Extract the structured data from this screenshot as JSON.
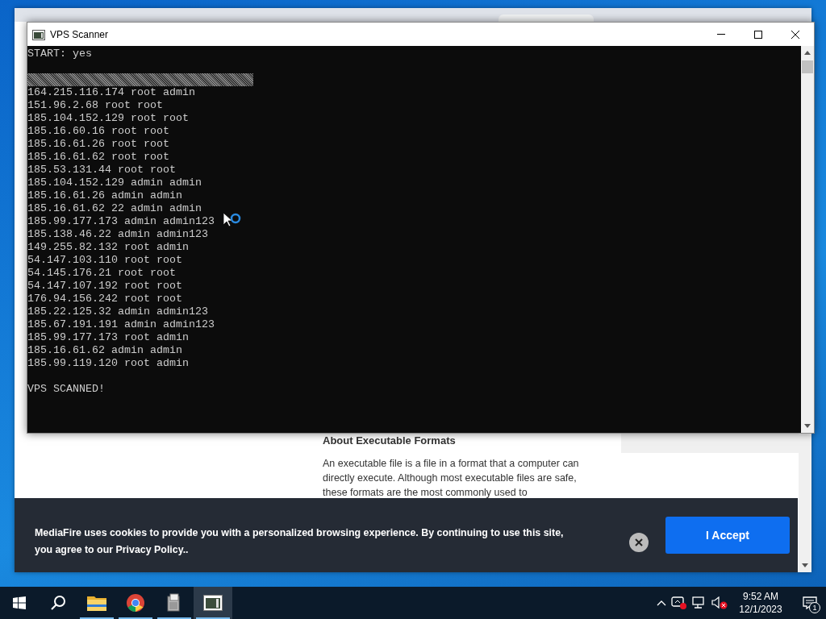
{
  "console_window": {
    "title": "VPS Scanner",
    "lines": [
      {
        "kind": "text",
        "text": "START: yes"
      },
      {
        "kind": "blank"
      },
      {
        "kind": "bar"
      },
      {
        "kind": "text",
        "text": "164.215.116.174 root admin"
      },
      {
        "kind": "text",
        "text": "151.96.2.68 root root"
      },
      {
        "kind": "text",
        "text": "185.104.152.129 root root"
      },
      {
        "kind": "text",
        "text": "185.16.60.16 root root"
      },
      {
        "kind": "text",
        "text": "185.16.61.26 root root"
      },
      {
        "kind": "text",
        "text": "185.16.61.62 root root"
      },
      {
        "kind": "text",
        "text": "185.53.131.44 root root"
      },
      {
        "kind": "text",
        "text": "185.104.152.129 admin admin"
      },
      {
        "kind": "text",
        "text": "185.16.61.26 admin admin"
      },
      {
        "kind": "text",
        "text": "185.16.61.62 22 admin admin"
      },
      {
        "kind": "text",
        "text": "185.99.177.173 admin admin123"
      },
      {
        "kind": "text",
        "text": "185.138.46.22 admin admin123"
      },
      {
        "kind": "text",
        "text": "149.255.82.132 root admin"
      },
      {
        "kind": "text",
        "text": "54.147.103.110 root root"
      },
      {
        "kind": "text",
        "text": "54.145.176.21 root root"
      },
      {
        "kind": "text",
        "text": "54.147.107.192 root root"
      },
      {
        "kind": "text",
        "text": "176.94.156.242 root root"
      },
      {
        "kind": "text",
        "text": "185.22.125.32 admin admin123"
      },
      {
        "kind": "text",
        "text": "185.67.191.191 admin admin123"
      },
      {
        "kind": "text",
        "text": "185.99.177.173 root admin"
      },
      {
        "kind": "text",
        "text": "185.16.61.62 admin admin"
      },
      {
        "kind": "text",
        "text": "185.99.119.120 root admin"
      },
      {
        "kind": "blank"
      },
      {
        "kind": "text",
        "text": "VPS SCANNED!"
      }
    ]
  },
  "browser": {
    "heading": "About Executable Formats",
    "paragraph": "An executable file is a file in a format that a computer can directly execute. Although most executable files are safe, these formats are the most commonly used to"
  },
  "cookie_banner": {
    "text": "MediaFire uses cookies to provide you with a personalized browsing experience. By continuing to use this site, you agree to our Privacy Policy..",
    "accept_button": "I Accept"
  },
  "taskbar": {
    "apps": [
      {
        "kind": "folder",
        "selected": false
      },
      {
        "kind": "browser",
        "selected": false
      },
      {
        "kind": "installer",
        "selected": false
      },
      {
        "kind": "console",
        "selected": true
      }
    ],
    "time": "9:52 AM",
    "date": "12/1/2023",
    "notification_count": "1"
  }
}
